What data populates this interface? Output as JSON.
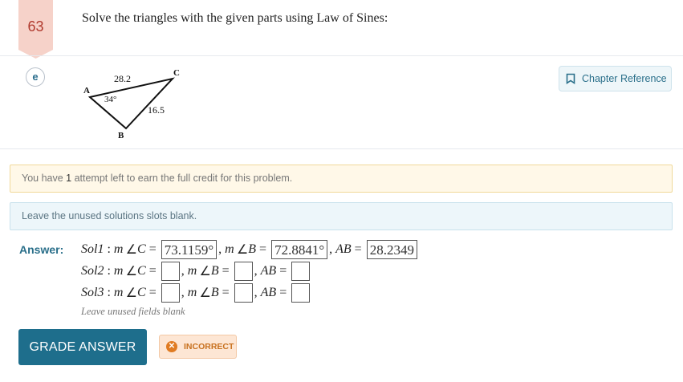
{
  "problem": {
    "number": "63",
    "title": "Solve the triangles with the given parts using Law of Sines:",
    "part_label": "e"
  },
  "chapter_reference": {
    "label": "Chapter Reference",
    "icon": "bookmark-icon"
  },
  "figure": {
    "vertex_a": "A",
    "vertex_b": "B",
    "vertex_c": "C",
    "side_ac": "28.2",
    "side_bc": "16.5",
    "angle_a": "34°"
  },
  "notice": {
    "prefix": "You have ",
    "count": "1",
    "suffix": " attempt left to earn the full credit for this problem."
  },
  "info": {
    "text": "Leave the unused solutions slots blank."
  },
  "answer": {
    "label": "Answer:",
    "rows": [
      {
        "sol": "Sol1",
        "mC": "73.1159°",
        "mB": "72.8841°",
        "AB": "28.2349"
      },
      {
        "sol": "Sol2",
        "mC": "",
        "mB": "",
        "AB": ""
      },
      {
        "sol": "Sol3",
        "mC": "",
        "mB": "",
        "AB": ""
      }
    ],
    "hint": "Leave unused fields blank"
  },
  "grade_button": {
    "label": "GRADE ANSWER"
  },
  "status": {
    "label": "INCORRECT",
    "icon": "x-circle-icon"
  },
  "colors": {
    "accent": "#1e6e8c",
    "badge": "#f4c9c0",
    "warning": "#e07b22"
  }
}
